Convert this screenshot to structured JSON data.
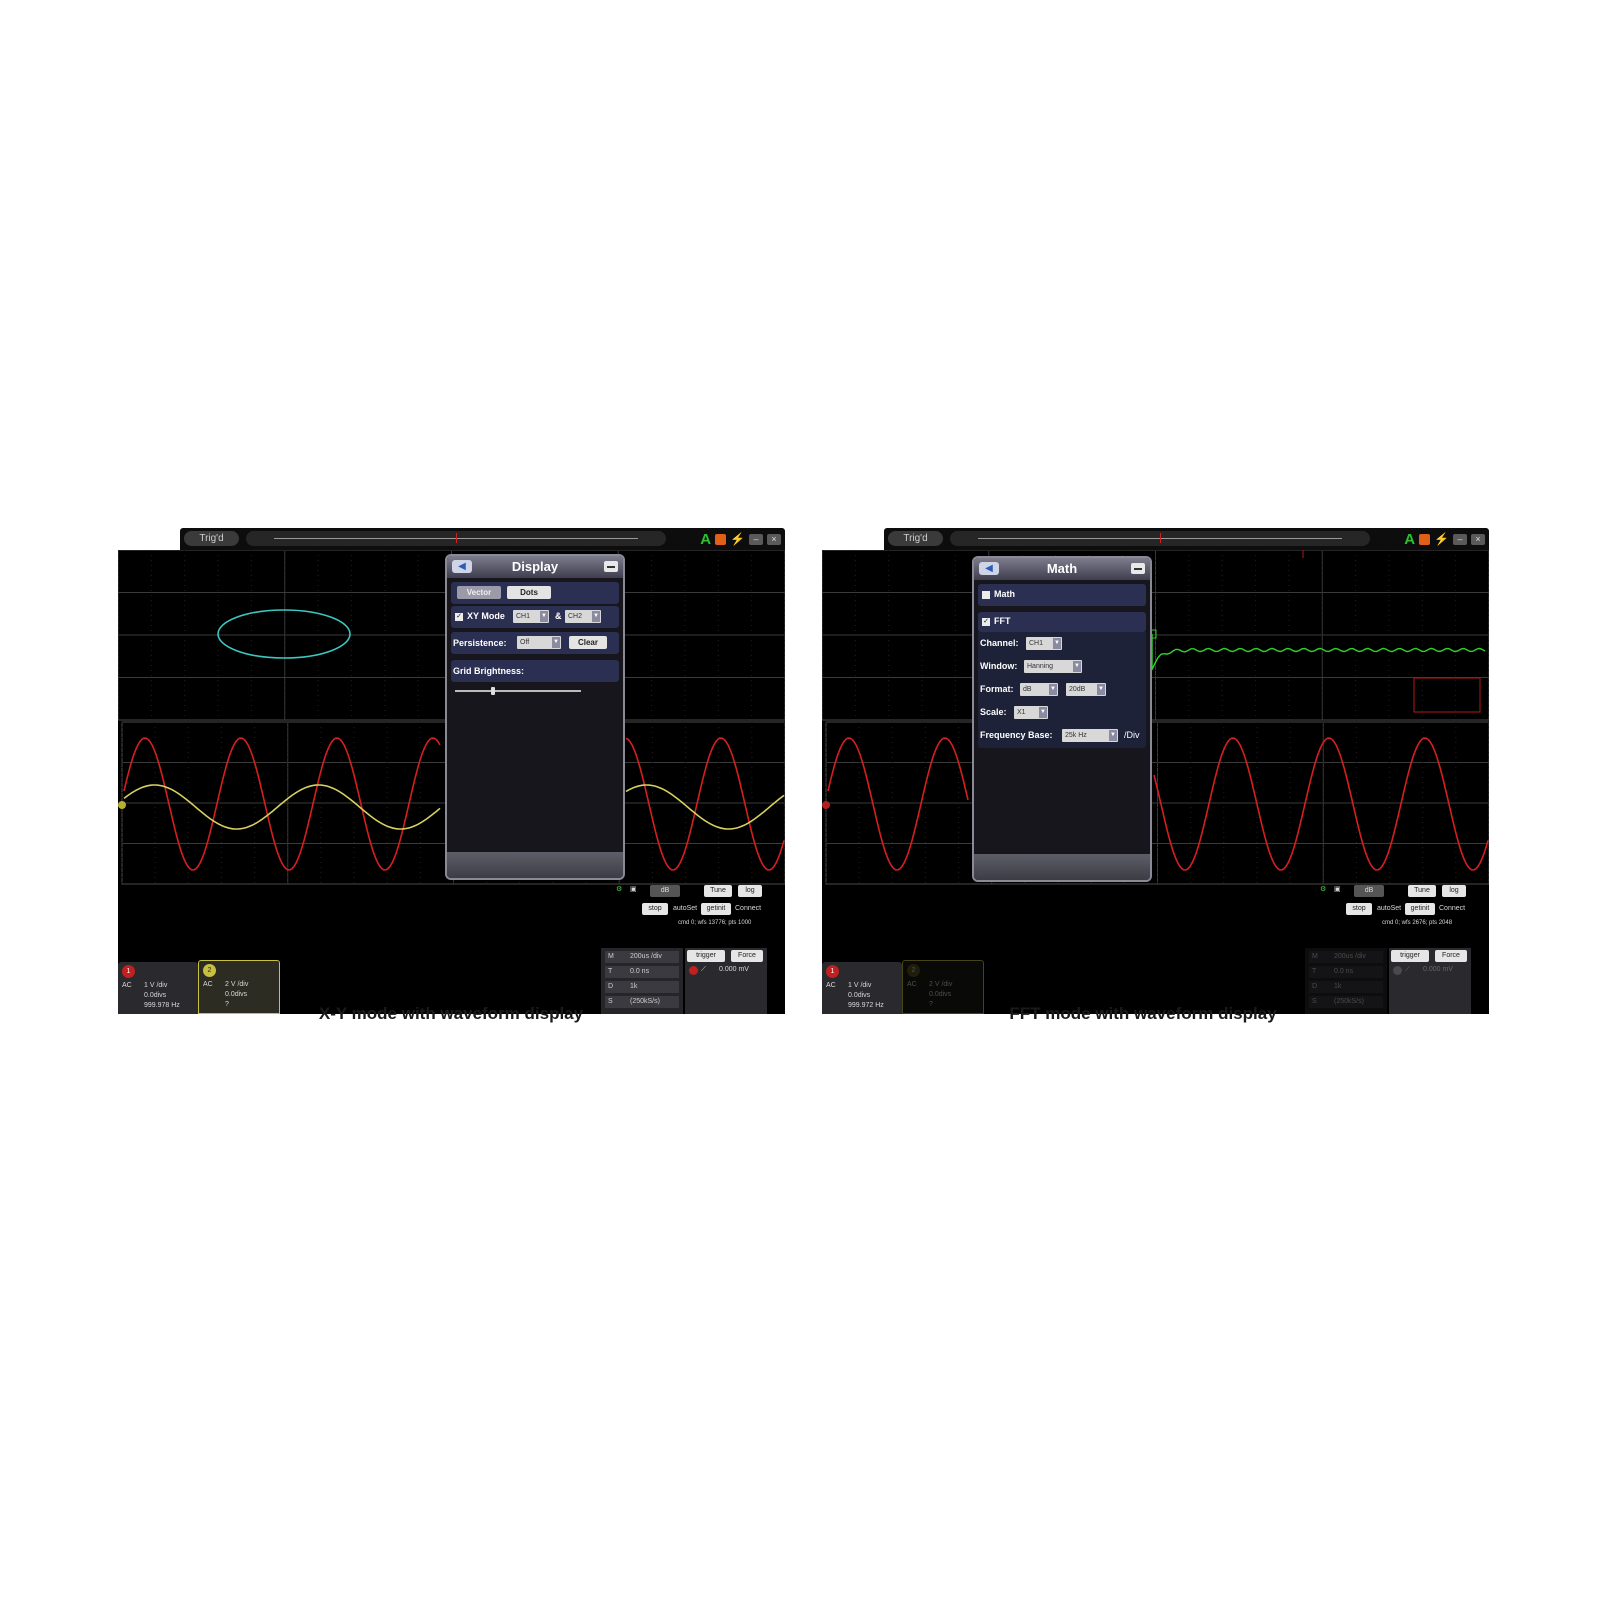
{
  "left": {
    "toolbar": {
      "tab": "Trig'd",
      "window_min": "–",
      "window_close": "×"
    },
    "panel": {
      "title": "Display",
      "btn_vector": "Vector",
      "btn_dots": "Dots",
      "xy_mode": "XY Mode",
      "xy_check": "✓",
      "ch_a": "CH1",
      "amp": "&",
      "ch_b": "CH2",
      "persistence": "Persistence:",
      "persistence_value": "Off",
      "clear": "Clear",
      "grid_brightness": "Grid Brightness:",
      "grid_brightness_level": 0.3
    },
    "controls": {
      "db": "dB",
      "tune": "Tune",
      "log": "log",
      "stop": "stop",
      "autoset": "autoSet",
      "getinit": "getinit",
      "connect": "Connect",
      "status_line": "cmd 0; wfs 13776; pts 1000"
    },
    "ch1": {
      "icon": "1",
      "coupling": "AC",
      "volts": "1 V /div",
      "offset": "0.0divs",
      "freq": "999.978 Hz"
    },
    "ch2": {
      "icon": "2",
      "coupling": "AC",
      "volts": "2 V /div",
      "offset": "0.0divs",
      "freq": "?"
    },
    "timebase": {
      "rows": [
        {
          "k": "M",
          "v": "200us /div"
        },
        {
          "k": "T",
          "v": "0.0 ns"
        },
        {
          "k": "D",
          "v": "1k"
        },
        {
          "k": "S",
          "v": "(250kS/s)"
        }
      ]
    },
    "trigger": {
      "btn": "trigger",
      "force": "Force",
      "level": "0.000 mV"
    },
    "caption": "X-Y mode with waveform display"
  },
  "right": {
    "toolbar": {
      "tab": "Trig'd",
      "window_min": "–",
      "window_close": "×"
    },
    "panel": {
      "title": "Math",
      "math": "Math",
      "fft": "FFT",
      "fft_check": "✓",
      "channel": "Channel:",
      "channel_value": "CH1",
      "window": "Window:",
      "window_value": "Hanning",
      "format": "Format:",
      "format_value": "dB",
      "format_scale": "20dB",
      "scale": "Scale:",
      "scale_value": "X1",
      "freq_base": "Frequency Base:",
      "freq_base_value": "25k Hz",
      "per_div": "/Div"
    },
    "controls": {
      "db": "dB",
      "tune": "Tune",
      "log": "log",
      "stop": "stop",
      "autoset": "autoSet",
      "getinit": "getinit",
      "connect": "Connect",
      "status_line": "cmd 0; wfs 2676; pts 2048"
    },
    "ch1": {
      "icon": "1",
      "coupling": "AC",
      "volts": "1 V /div",
      "offset": "0.0divs",
      "freq": "999.972 Hz"
    },
    "ch2": {
      "icon": "2",
      "coupling": "AC",
      "volts": "2 V /div",
      "offset": "0.0divs",
      "freq": "?"
    },
    "timebase": {
      "rows": [
        {
          "k": "M",
          "v": "200us /div"
        },
        {
          "k": "T",
          "v": "0.0 ns"
        },
        {
          "k": "D",
          "v": "1k"
        },
        {
          "k": "S",
          "v": "(250kS/s)"
        }
      ]
    },
    "trigger": {
      "btn": "trigger",
      "force": "Force",
      "level": "0.000 mV"
    },
    "caption": "FFT mode with waveform display"
  },
  "colors": {
    "ch1": "#d22020",
    "ch2": "#d8d060",
    "xy": "#3cc8c0",
    "fft": "#30d030",
    "grid": "#3a3a3a"
  }
}
